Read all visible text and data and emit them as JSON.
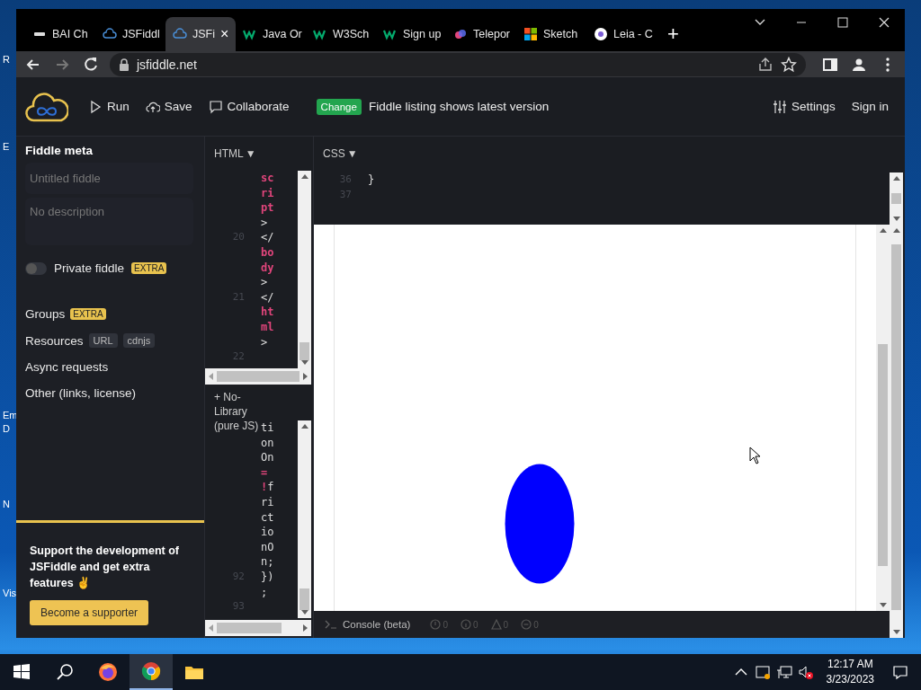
{
  "desktop": {
    "icon_labels": [
      "R",
      "E",
      "Em",
      "D",
      "N",
      "Vis"
    ]
  },
  "browser": {
    "tabs": [
      {
        "label": "BAI Ch",
        "kind": "bai",
        "selected": false
      },
      {
        "label": "JSFiddl",
        "kind": "jsfiddle",
        "selected": false
      },
      {
        "label": "JSFi",
        "kind": "jsfiddle",
        "selected": true,
        "close": "×"
      },
      {
        "label": "Java Or",
        "kind": "w3",
        "selected": false
      },
      {
        "label": "W3Sch",
        "kind": "w3",
        "selected": false
      },
      {
        "label": "Sign up",
        "kind": "w3",
        "selected": false
      },
      {
        "label": "Telepor",
        "kind": "teleport",
        "selected": false
      },
      {
        "label": "Sketch",
        "kind": "microsoft",
        "selected": false
      },
      {
        "label": "Leia - C",
        "kind": "leia",
        "selected": false
      }
    ],
    "new_tab": "+",
    "address": "jsfiddle.net"
  },
  "fiddle": {
    "toolbar": {
      "run": "Run",
      "save": "Save",
      "collaborate": "Collaborate",
      "change_badge": "Change",
      "notice": "Fiddle listing shows latest version",
      "settings": "Settings",
      "sign_in": "Sign in"
    },
    "sidebar": {
      "heading": "Fiddle meta",
      "title_placeholder": "Untitled fiddle",
      "description_placeholder": "No description",
      "private": {
        "label": "Private fiddle",
        "badge": "EXTRA",
        "on": false
      },
      "sections": [
        {
          "label": "Groups",
          "badges": [
            {
              "text": "EXTRA",
              "kind": "extra"
            }
          ]
        },
        {
          "label": "Resources",
          "badges": [
            {
              "text": "URL",
              "kind": "tag"
            },
            {
              "text": "cdnjs",
              "kind": "tag"
            }
          ]
        },
        {
          "label": "Async requests"
        },
        {
          "label": "Other (links, license)"
        }
      ],
      "support": {
        "text": "Support the development of JSFiddle and get extra features ✌️",
        "button": "Become a supporter"
      }
    },
    "html_panel": {
      "title": "HTML",
      "caret": "▼",
      "lines": [
        {
          "tokens": [
            {
              "text": "sc",
              "kind": "tag"
            }
          ]
        },
        {
          "tokens": [
            {
              "text": "ri",
              "kind": "tag"
            }
          ]
        },
        {
          "tokens": [
            {
              "text": "pt",
              "kind": "tag"
            }
          ]
        },
        {
          "tokens": [
            {
              "text": ">",
              "kind": "plain"
            }
          ]
        },
        {
          "num": "20",
          "tokens": [
            {
              "text": "</",
              "kind": "plain"
            }
          ]
        },
        {
          "tokens": [
            {
              "text": "bo",
              "kind": "tag"
            }
          ]
        },
        {
          "tokens": [
            {
              "text": "dy",
              "kind": "tag"
            }
          ]
        },
        {
          "tokens": [
            {
              "text": ">",
              "kind": "plain"
            }
          ]
        },
        {
          "num": "21",
          "tokens": [
            {
              "text": "</",
              "kind": "plain"
            }
          ]
        },
        {
          "tokens": [
            {
              "text": "ht",
              "kind": "tag"
            }
          ]
        },
        {
          "tokens": [
            {
              "text": "ml",
              "kind": "tag"
            }
          ]
        },
        {
          "tokens": [
            {
              "text": ">",
              "kind": "plain"
            }
          ]
        },
        {
          "num": "22"
        }
      ]
    },
    "js_panel": {
      "label": "+ No-Library (pure JS)",
      "lines": [
        {
          "tokens": [
            {
              "text": "ti",
              "kind": "plain"
            }
          ]
        },
        {
          "tokens": [
            {
              "text": "on",
              "kind": "plain"
            }
          ]
        },
        {
          "tokens": [
            {
              "text": "On",
              "kind": "plain"
            }
          ]
        },
        {
          "tokens": [
            {
              "text": "=",
              "kind": "tag"
            }
          ]
        },
        {
          "tokens": [
            {
              "text": "!",
              "kind": "tag"
            },
            {
              "text": "f",
              "kind": "plain"
            }
          ]
        },
        {
          "tokens": [
            {
              "text": "ri",
              "kind": "plain"
            }
          ]
        },
        {
          "tokens": [
            {
              "text": "ct",
              "kind": "plain"
            }
          ]
        },
        {
          "tokens": [
            {
              "text": "io",
              "kind": "plain"
            }
          ]
        },
        {
          "tokens": [
            {
              "text": "nO",
              "kind": "plain"
            }
          ]
        },
        {
          "tokens": [
            {
              "text": "n;",
              "kind": "plain"
            }
          ]
        },
        {
          "num": "92",
          "tokens": [
            {
              "text": "})",
              "kind": "plain"
            }
          ]
        },
        {
          "tokens": [
            {
              "text": ";",
              "kind": "plain"
            }
          ]
        },
        {
          "num": "93"
        }
      ]
    },
    "css_panel": {
      "title": "CSS",
      "caret": "▼",
      "lines": [
        {
          "num": "36",
          "tokens": [
            {
              "text": "}",
              "kind": "plain"
            }
          ]
        },
        {
          "num": "37"
        }
      ]
    },
    "console": {
      "label": "Console (beta)",
      "counters": [
        {
          "kind": "error",
          "count": "0"
        },
        {
          "kind": "info",
          "count": "0"
        },
        {
          "kind": "warning",
          "count": "0"
        },
        {
          "kind": "log",
          "count": "0"
        }
      ]
    }
  },
  "taskbar": {
    "apps": [
      {
        "kind": "firefox",
        "selected": false
      },
      {
        "kind": "chrome",
        "selected": true
      },
      {
        "kind": "explorer",
        "selected": false
      }
    ],
    "time": "12:17 AM",
    "date": "3/23/2023"
  }
}
